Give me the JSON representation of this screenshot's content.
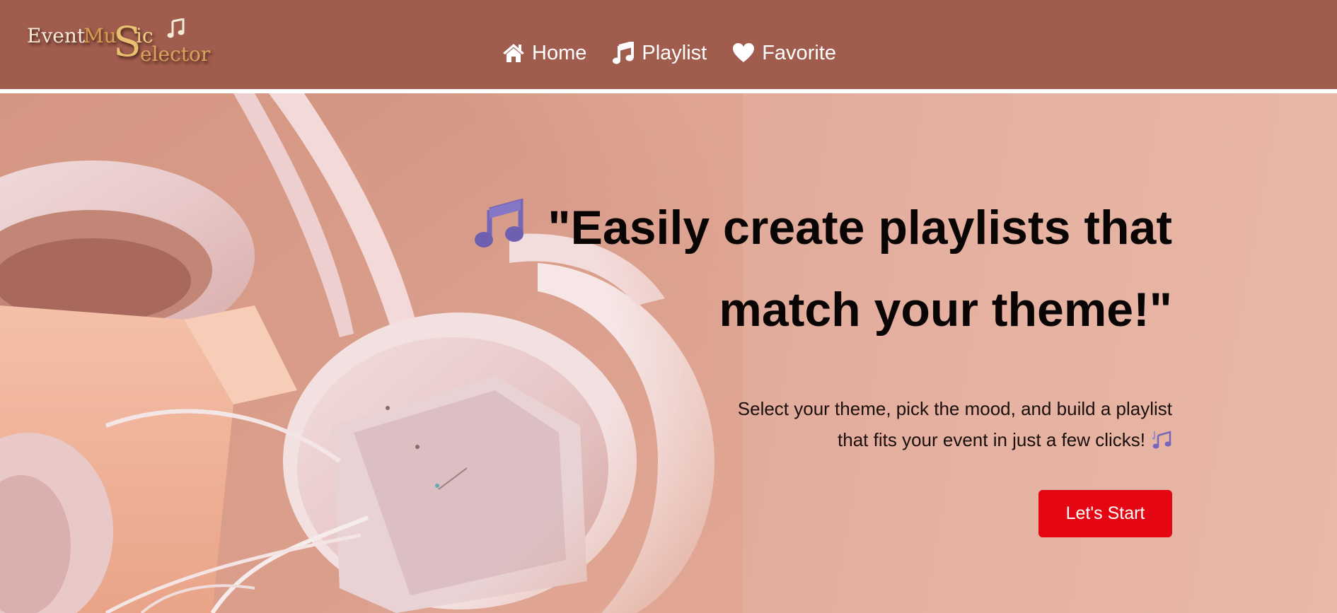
{
  "logo": {
    "word_event": "Event",
    "word_music_start": "Mu",
    "word_music_end": "ic",
    "big_letter": "S",
    "word_selector_rest": "elector",
    "icon": "music-note-icon"
  },
  "nav": {
    "items": [
      {
        "label": "Home",
        "icon": "home-icon"
      },
      {
        "label": "Playlist",
        "icon": "music-note-icon"
      },
      {
        "label": "Favorite",
        "icon": "heart-icon"
      }
    ]
  },
  "hero": {
    "title_line_1": "\"Easily create playlists that",
    "title_line_2": "match your theme!\"",
    "title_emoji": "music-note-emoji",
    "subtitle_line_1": "Select your theme, pick the mood, and build a playlist",
    "subtitle_line_2": "that fits your event in just a few clicks!",
    "subtitle_emoji": "music-notes-emoji",
    "cta_label": "Let's Start"
  },
  "colors": {
    "header_bg": "#a05c4d",
    "hero_bg": "#e2a897",
    "cta_bg": "#e40613",
    "emoji_purple": "#7566b8"
  }
}
